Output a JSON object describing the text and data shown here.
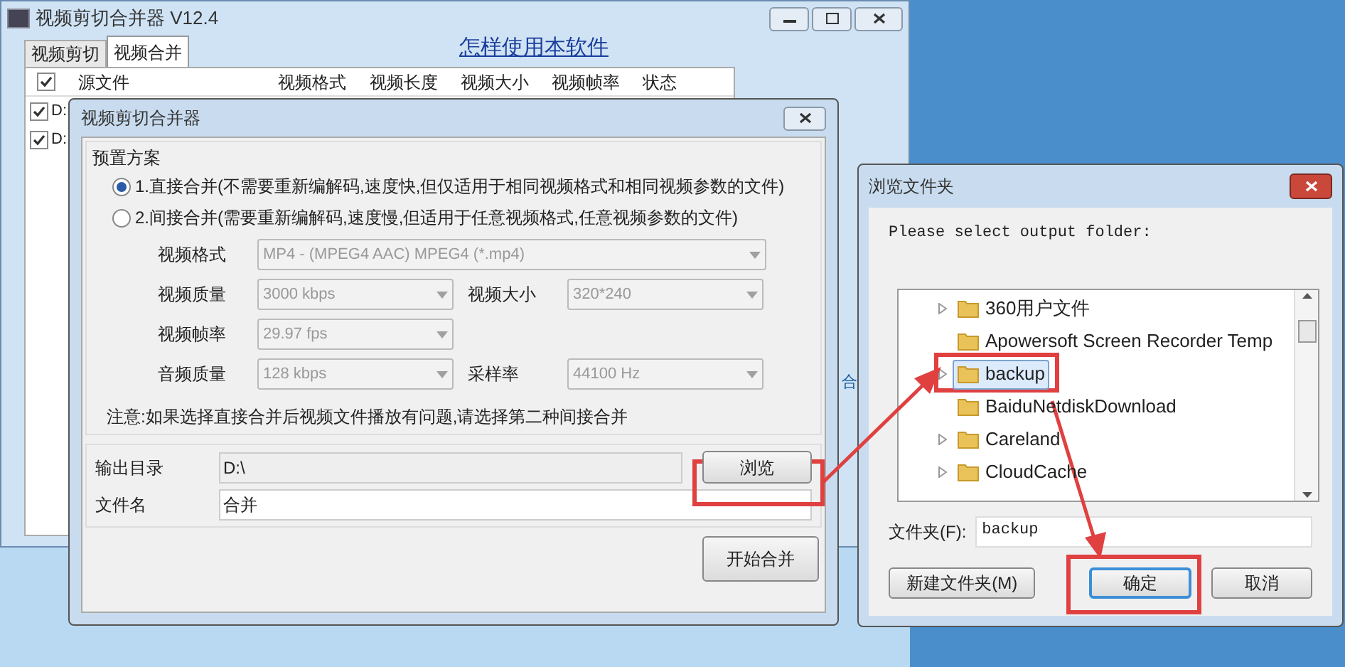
{
  "main_window": {
    "title": "视频剪切合并器 V12.4",
    "tabs": [
      {
        "label": "视频剪切",
        "selected": false
      },
      {
        "label": "视频合并",
        "selected": true
      }
    ],
    "help_link": "怎样使用本软件",
    "header_checked": true,
    "columns": [
      "源文件",
      "视频格式",
      "视频长度",
      "视频大小",
      "视频帧率",
      "状态"
    ],
    "rows": [
      {
        "file": "D:",
        "checked": true
      },
      {
        "file": "D:",
        "checked": true
      }
    ],
    "side_text": "合"
  },
  "merge_dialog": {
    "title": "视频剪切合并器",
    "preset_group": "预置方案",
    "modes": [
      {
        "label": "1.直接合并(不需要重新编解码,速度快,但仅适用于相同视频格式和相同视频参数的文件)",
        "selected": true
      },
      {
        "label": "2.间接合并(需要重新编解码,速度慢,但适用于任意视频格式,任意视频参数的文件)",
        "selected": false
      }
    ],
    "setting_rows": [
      {
        "fields": [
          {
            "label": "视频格式",
            "value": "MP4 - (MPEG4 AAC) MPEG4 (*.mp4)",
            "kind": "wide",
            "disabled": true
          }
        ]
      },
      {
        "fields": [
          {
            "label": "视频质量",
            "value": "3000 kbps",
            "kind": "narrow",
            "disabled": true
          },
          {
            "label": "视频大小",
            "value": "320*240",
            "kind": "narrow",
            "disabled": true
          }
        ]
      },
      {
        "fields": [
          {
            "label": "视频帧率",
            "value": "29.97 fps",
            "kind": "narrow",
            "disabled": true
          }
        ]
      },
      {
        "fields": [
          {
            "label": "音频质量",
            "value": "128 kbps",
            "kind": "narrow",
            "disabled": true
          },
          {
            "label": "采样率",
            "value": "44100 Hz",
            "kind": "narrow",
            "disabled": true
          }
        ]
      }
    ],
    "note": "注意:如果选择直接合并后视频文件播放有问题,请选择第二种间接合并",
    "output_label": "输出目录",
    "output_value": "D:\\",
    "browse_button": "浏览",
    "filename_label": "文件名",
    "filename_value": "合并",
    "start_button": "开始合并"
  },
  "folder_dialog": {
    "title": "浏览文件夹",
    "prompt": "Please select output folder:",
    "folders": [
      {
        "name": "360用户文件",
        "expandable": true,
        "selected": false
      },
      {
        "name": "Apowersoft Screen Recorder Temp",
        "expandable": false,
        "selected": false
      },
      {
        "name": "backup",
        "expandable": true,
        "selected": true
      },
      {
        "name": "BaiduNetdiskDownload",
        "expandable": false,
        "selected": false
      },
      {
        "name": "Careland",
        "expandable": true,
        "selected": false
      },
      {
        "name": "CloudCache",
        "expandable": true,
        "selected": false
      }
    ],
    "folder_label": "文件夹(F):",
    "folder_value": "backup",
    "buttons": [
      {
        "label": "新建文件夹(M)",
        "kind": "normal"
      },
      {
        "label": "确定",
        "kind": "default"
      },
      {
        "label": "取消",
        "kind": "normal"
      }
    ]
  }
}
